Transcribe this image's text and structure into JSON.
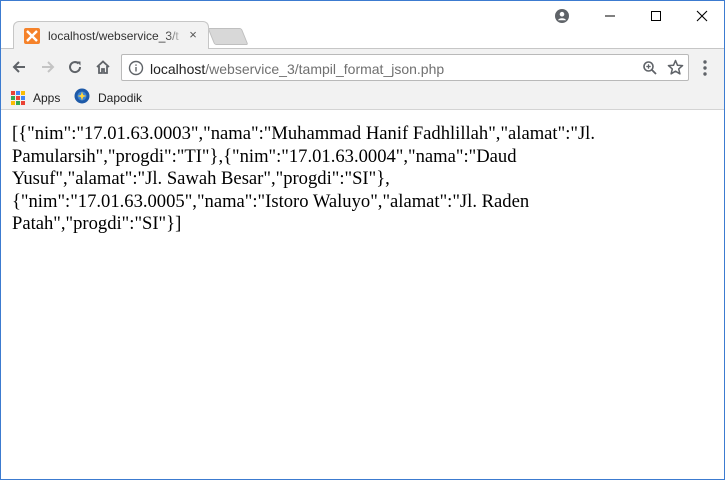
{
  "tab": {
    "title": "localhost/webservice_3/t",
    "favicon": "xampp-icon",
    "close": "×"
  },
  "window_controls": [
    "profile-icon",
    "minimize-icon",
    "maximize-icon",
    "close-icon"
  ],
  "toolbar": {
    "back": "back-arrow-icon",
    "forward": "forward-arrow-icon",
    "reload": "reload-icon",
    "home": "home-icon"
  },
  "address_bar": {
    "host": "localhost",
    "path": "/webservice_3/tampil_format_json.php",
    "zoom_icon": "zoom-icon",
    "star_icon": "bookmark-star-icon"
  },
  "bookmarks": [
    {
      "label": "Apps",
      "icon": "apps-grid-icon"
    },
    {
      "label": "Dapodik",
      "icon": "dapodik-logo-icon"
    }
  ],
  "page": {
    "body_text": "[{\"nim\":\"17.01.63.0003\",\"nama\":\"Muhammad Hanif Fadhlillah\",\"alamat\":\"Jl. Pamularsih\",\"progdi\":\"TI\"},{\"nim\":\"17.01.63.0004\",\"nama\":\"Daud Yusuf\",\"alamat\":\"Jl. Sawah Besar\",\"progdi\":\"SI\"},{\"nim\":\"17.01.63.0005\",\"nama\":\"Istoro Waluyo\",\"alamat\":\"Jl. Raden Patah\",\"progdi\":\"SI\"}]"
  },
  "colors": {
    "window_border": "#3c7bd0",
    "toolbar_bg": "#f2f2f2",
    "favicon": "#f5822a"
  }
}
